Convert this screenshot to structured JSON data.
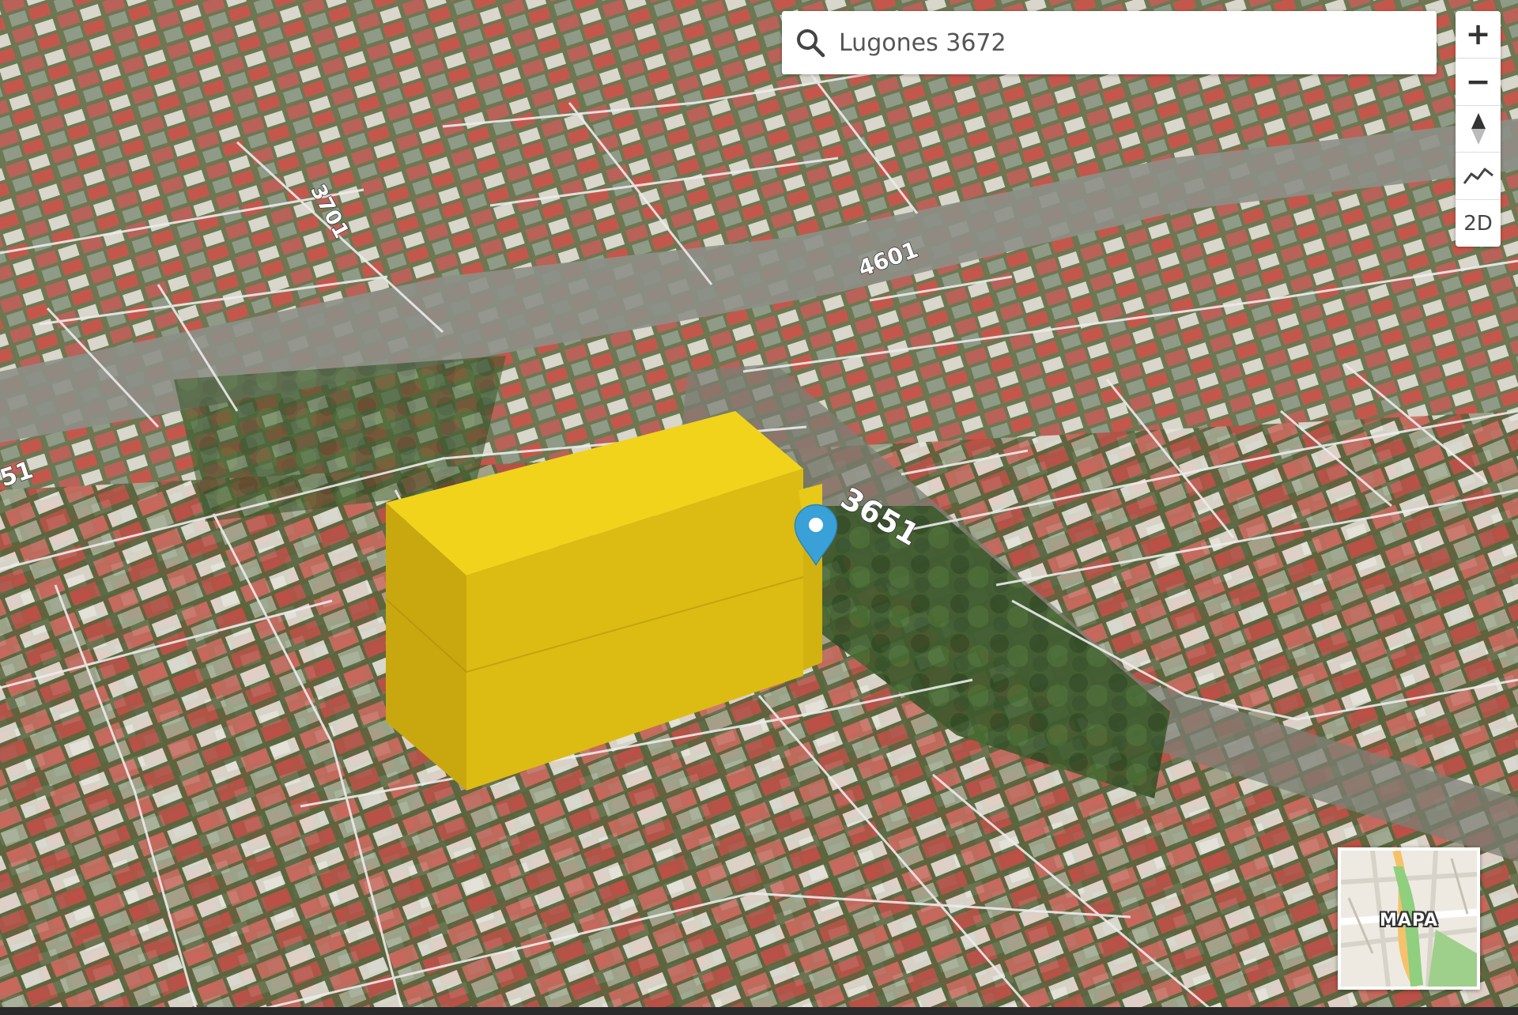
{
  "search": {
    "value": "Lugones 3672",
    "icon": "search-icon"
  },
  "controls": {
    "zoom_in_label": "+",
    "zoom_out_label": "−",
    "mode_label": "2D"
  },
  "map": {
    "view": "3D satellite",
    "street_labels": [
      "3701",
      "4601",
      "3651",
      "51"
    ],
    "highlight_color": "#e3c21a",
    "marker_color": "#3aa0d8"
  },
  "minimap": {
    "label": "MAPA"
  }
}
